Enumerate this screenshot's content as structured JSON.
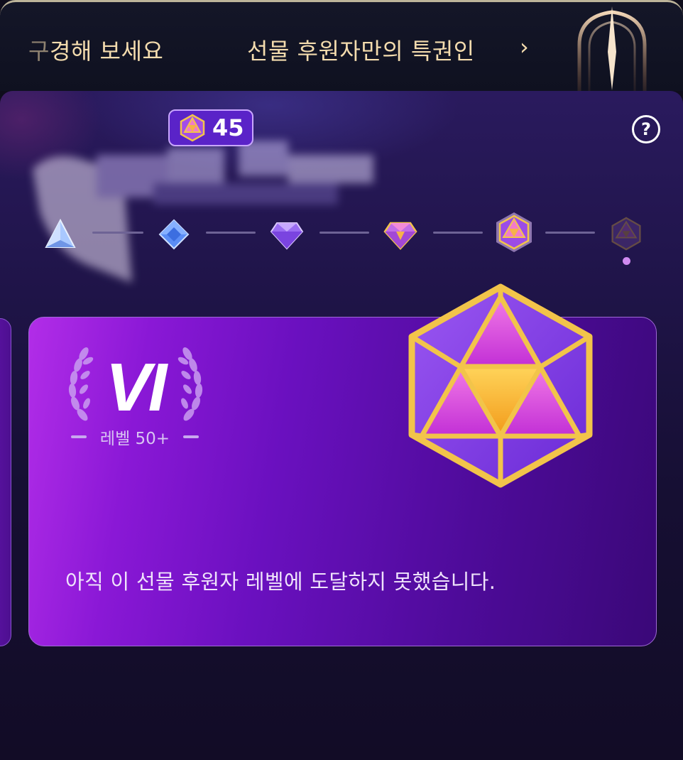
{
  "banner": {
    "left_fragment": "구",
    "left_text": "경해 보세요",
    "right_text": "선물 후원자만의 특권인 ",
    "right_chevron": "›",
    "arch_icon": "ornament-arch-icon"
  },
  "header": {
    "help_icon": "question-circle-icon",
    "help_label": "?"
  },
  "gem_badge": {
    "icon": "pink-gem-icon",
    "count": "45"
  },
  "tiers": [
    {
      "name": "tier-1",
      "icon": "pale-triangle-gem-icon",
      "state": "achieved"
    },
    {
      "name": "tier-2",
      "icon": "blue-diamond-gem-icon",
      "state": "achieved"
    },
    {
      "name": "tier-3",
      "icon": "violet-cut-gem-icon",
      "state": "achieved"
    },
    {
      "name": "tier-4",
      "icon": "pink-cut-gem-icon",
      "state": "achieved"
    },
    {
      "name": "tier-5",
      "icon": "hexagon-gem-icon",
      "state": "current"
    },
    {
      "name": "tier-6",
      "icon": "dim-hexagon-gem-icon",
      "state": "locked"
    }
  ],
  "card": {
    "level_roman": "VI",
    "level_label": "레벨 50+",
    "laurel_icon": "laurel-wreath-icon",
    "gem_icon": "icosahedron-gem-icon",
    "message": "아직 이 선물 후원자 레벨에 도달하지 못했습니다."
  },
  "colors": {
    "banner_text": "#f4dcae",
    "card_start": "#b22de8",
    "card_end": "#3a0878",
    "gold": "#e9c24a"
  }
}
